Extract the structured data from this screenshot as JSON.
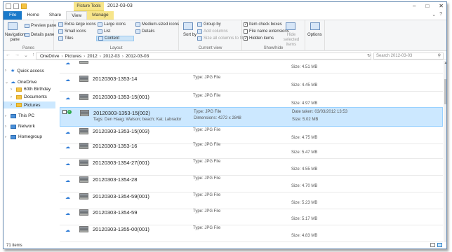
{
  "title": "2012-03-03",
  "context_tab": "Picture Tools",
  "tabs": {
    "file": "File",
    "home": "Home",
    "share": "Share",
    "view": "View",
    "manage": "Manage"
  },
  "ribbon": {
    "panes": {
      "label": "Panes",
      "navigation_pane": "Navigation pane",
      "preview_pane": "Preview pane",
      "details_pane": "Details pane"
    },
    "layout": {
      "label": "Layout",
      "extra_large": "Extra large icons",
      "large": "Large icons",
      "medium": "Medium-sized icons",
      "small": "Small icons",
      "list": "List",
      "details": "Details",
      "tiles": "Tiles",
      "content": "Content"
    },
    "current_view": {
      "label": "Current view",
      "sort_by": "Sort by",
      "group_by": "Group by",
      "add_columns": "Add columns",
      "size_all": "Size all columns to fit"
    },
    "show_hide": {
      "label": "Show/hide",
      "item_check_boxes": "Item check boxes",
      "file_name_extensions": "File name extensions",
      "hidden_items": "Hidden items",
      "hide_selected": "Hide selected items"
    },
    "options": "Options"
  },
  "breadcrumb": [
    "OneDrive",
    "Pictures",
    "2012",
    "2012-03",
    "2012-03-03"
  ],
  "search_placeholder": "Search 2012-03-03",
  "nav": {
    "quick_access": "Quick access",
    "onedrive": "OneDrive",
    "sixtieth": "60th Birthday",
    "documents": "Documents",
    "pictures": "Pictures",
    "this_pc": "This PC",
    "network": "Network",
    "homegroup": "Homegroup"
  },
  "files": [
    {
      "name": "",
      "type": "",
      "size": "Size: 4.51 MB"
    },
    {
      "name": "20120303-1353-14",
      "type": "Type: JPG File",
      "size": "Size: 4.45 MB"
    },
    {
      "name": "20120303-1353-15(001)",
      "type": "Type: JPG File",
      "size": "Size: 4.97 MB"
    },
    {
      "name": "20120303-1353-15(002)",
      "type": "Type: JPG File",
      "tags": "Tags: Den Haag; Watson; beach; Kai; Labrador",
      "dimensions": "Dimensions: 4272 x 2848",
      "date": "Date taken: 03/03/2012 13:53",
      "size": "Size: 5.02 MB"
    },
    {
      "name": "20120303-1353-15(003)",
      "type": "Type: JPG File",
      "size": "Size: 4.75 MB"
    },
    {
      "name": "20120303-1353-16",
      "type": "Type: JPG File",
      "size": "Size: 5.47 MB"
    },
    {
      "name": "20120303-1354-27(001)",
      "type": "Type: JPG File",
      "size": "Size: 4.55 MB"
    },
    {
      "name": "20120303-1354-28",
      "type": "Type: JPG File",
      "size": "Size: 4.70 MB"
    },
    {
      "name": "20120303-1354-59(001)",
      "type": "Type: JPG File",
      "size": "Size: 5.23 MB"
    },
    {
      "name": "20120303-1354-59",
      "type": "Type: JPG File",
      "size": "Size: 5.17 MB"
    },
    {
      "name": "20120303-1355-00(001)",
      "type": "Type: JPG File",
      "size": "Size: 4.83 MB"
    }
  ],
  "status": "71 items",
  "colors": {
    "accent": "#1979ca",
    "selection": "#cce8ff",
    "context": "#f7e58a"
  }
}
